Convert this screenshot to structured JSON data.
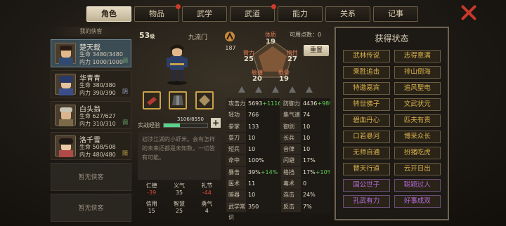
{
  "tabs": [
    {
      "label": "角色",
      "active": true,
      "dot": false
    },
    {
      "label": "物品",
      "dot": true
    },
    {
      "label": "武学",
      "dot": false
    },
    {
      "label": "武道",
      "dot": true
    },
    {
      "label": "能力",
      "dot": false
    },
    {
      "label": "关系",
      "dot": false
    },
    {
      "label": "记事",
      "dot": false
    }
  ],
  "roster": {
    "title": "我的侠客",
    "chars": [
      {
        "name": "楚天载",
        "hp": "生命 3480/3480",
        "mp": "内力 1000/1000",
        "tag": "调"
      },
      {
        "name": "华青青",
        "hp": "生命 380/380",
        "mp": "内力 390/390",
        "tag": "阴"
      },
      {
        "name": "白头翁",
        "hp": "生命 627/627",
        "mp": "内力 310/310",
        "tag": "调"
      },
      {
        "name": "洛千雪",
        "hp": "生命 508/508",
        "mp": "内力 480/480",
        "tag": "阳"
      }
    ],
    "empty": [
      "暂无侠客",
      "暂无侠客"
    ]
  },
  "hero": {
    "level": "53",
    "level_unit": "级",
    "sect": "九流门",
    "xp_label": "实战经验",
    "xp_text": "3106/8550",
    "xp_ratio": 0.363,
    "bio": "初涉江湖的小虾米。会有怎样的未来还都是未知数，一切皆有可能。",
    "traits": [
      {
        "k": "仁德",
        "v": "-39",
        "neg": true
      },
      {
        "k": "义气",
        "v": "35"
      },
      {
        "k": "礼节",
        "v": "-44",
        "neg": true
      },
      {
        "k": "信用",
        "v": "15"
      },
      {
        "k": "智慧",
        "v": "25"
      },
      {
        "k": "勇气",
        "v": "4"
      }
    ]
  },
  "attrs": {
    "points_label": "可用点数：",
    "points": "0",
    "reset": "重置",
    "potential": "187",
    "tizhi": {
      "k": "体质",
      "v": "19"
    },
    "wuxing": {
      "k": "悟性",
      "v": "27"
    },
    "genu": {
      "k": "根骨",
      "v": "19"
    },
    "minjie": {
      "k": "敏捷",
      "v": "20"
    },
    "biyong": {
      "k": "臂力",
      "v": "25"
    }
  },
  "stats": [
    [
      {
        "k": "攻击力",
        "v": "5693",
        "b": "+1116"
      },
      {
        "k": "防御力",
        "v": "4436",
        "b": "+989"
      }
    ],
    [
      {
        "k": "轻功",
        "v": "766",
        "b": ""
      },
      {
        "k": "集气速度",
        "v": "74",
        "b": ""
      }
    ],
    [
      {
        "k": "拳掌",
        "v": "133",
        "b": ""
      },
      {
        "k": "御剑",
        "v": "10",
        "b": ""
      }
    ],
    [
      {
        "k": "耍刀",
        "v": "10",
        "b": ""
      },
      {
        "k": "长兵",
        "v": "10",
        "b": ""
      }
    ],
    [
      {
        "k": "短兵",
        "v": "10",
        "b": ""
      },
      {
        "k": "音律",
        "v": "10",
        "b": ""
      }
    ],
    [
      {
        "k": "命中",
        "v": "100%",
        "b": ""
      },
      {
        "k": "闪避",
        "v": "17%",
        "b": ""
      }
    ],
    [
      {
        "k": "暴击",
        "v": "39%",
        "b": "+14%"
      },
      {
        "k": "格挡",
        "v": "17%",
        "b": "+10%"
      }
    ],
    [
      {
        "k": "医术",
        "v": "11",
        "b": ""
      },
      {
        "k": "毒术",
        "v": "0",
        "b": ""
      }
    ],
    [
      {
        "k": "暗器",
        "v": "10",
        "b": ""
      },
      {
        "k": "连击",
        "v": "24%",
        "b": ""
      }
    ],
    [
      {
        "k": "武学常识",
        "v": "350",
        "b": ""
      },
      {
        "k": "反击",
        "v": "7%",
        "b": ""
      }
    ]
  ],
  "states": {
    "title": "获得状态",
    "items": [
      {
        "t": "武林传说"
      },
      {
        "t": "志得意满"
      },
      {
        "t": "乘胜追击"
      },
      {
        "t": "排山倒海"
      },
      {
        "t": "特邀嘉宾"
      },
      {
        "t": "追风聖电"
      },
      {
        "t": "转世佛子"
      },
      {
        "t": "文武状元"
      },
      {
        "t": "碧血丹心"
      },
      {
        "t": "匹夫有责"
      },
      {
        "t": "口若悬河"
      },
      {
        "t": "博采众长"
      },
      {
        "t": "无师自通"
      },
      {
        "t": "扮猪吃虎"
      },
      {
        "t": "替天行道"
      },
      {
        "t": "云开日出"
      },
      {
        "t": "国公世子",
        "p": true
      },
      {
        "t": "聪颖过人",
        "p": true
      },
      {
        "t": "孔武有力",
        "p": true
      },
      {
        "t": "好事成双",
        "p": true
      }
    ]
  }
}
